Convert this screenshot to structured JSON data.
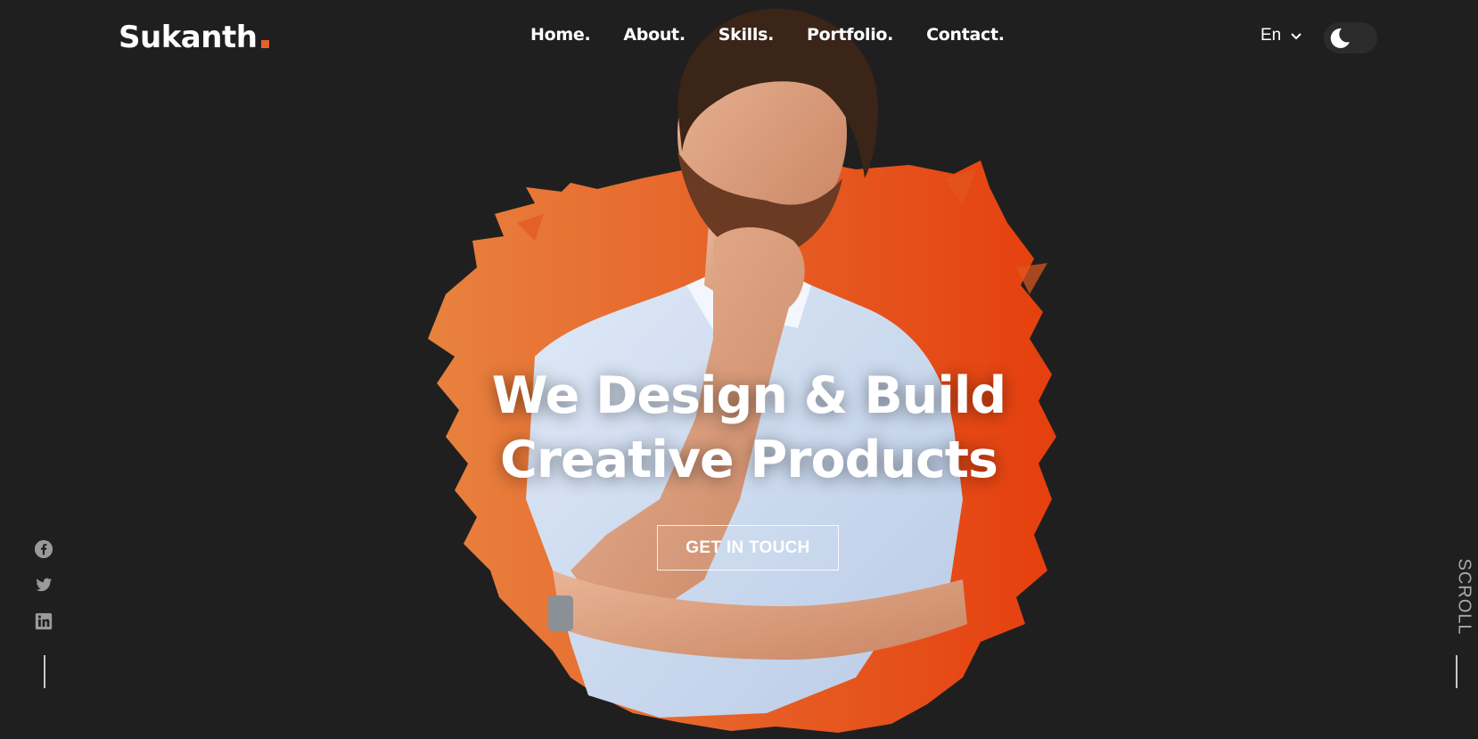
{
  "brand": {
    "name": "Sukanth",
    "accent_color": "#e8602c"
  },
  "nav": {
    "items": [
      {
        "label": "Home."
      },
      {
        "label": "About."
      },
      {
        "label": "Skills."
      },
      {
        "label": "Portfolio."
      },
      {
        "label": "Contact."
      }
    ]
  },
  "language": {
    "selected": "En",
    "icon": "chevron-down-icon"
  },
  "theme_toggle": {
    "icon": "moon-icon",
    "mode": "dark"
  },
  "hero": {
    "headline_line1": "We Design & Build",
    "headline_line2": "Creative Products",
    "cta_label": "GET IN TOUCH",
    "image": "man-thinking-portrait"
  },
  "social": [
    {
      "icon": "facebook-icon"
    },
    {
      "icon": "twitter-icon"
    },
    {
      "icon": "linkedin-icon"
    }
  ],
  "scroll_indicator": {
    "label": "SCROLL"
  },
  "colors": {
    "background": "#1f1f1f",
    "splash_start": "#e67a3a",
    "splash_end": "#e6420f",
    "text": "#ffffff"
  }
}
